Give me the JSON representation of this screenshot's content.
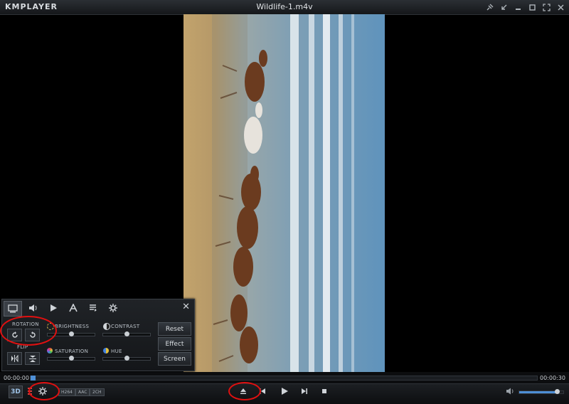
{
  "app": {
    "logo": "KMPLAYER",
    "title": "Wildlife-1.m4v"
  },
  "window_controls": [
    "pin-icon",
    "minimize-to-corner-icon",
    "minimize-icon",
    "maximize-icon",
    "fullscreen-icon",
    "close-icon"
  ],
  "panel": {
    "tabs": [
      "screen-icon",
      "audio-icon",
      "playback-icon",
      "subtitle-icon",
      "playlist-icon",
      "settings-icon"
    ],
    "rotation_label": "ROTATION",
    "flip_label": "FLIP",
    "brightness_label": "BRIGHTNESS",
    "contrast_label": "CONTRAST",
    "saturation_label": "SATURATION",
    "hue_label": "HUE",
    "brightness": 0.5,
    "contrast": 0.5,
    "saturation": 0.5,
    "hue": 0.5,
    "reset_label": "Reset",
    "effect_label": "Effect",
    "screen_label": "Screen",
    "close": "✕"
  },
  "seek": {
    "current": "00:00:00",
    "total": "00:00:30",
    "progress": 0.0
  },
  "controls": {
    "three_d": "3D",
    "codecs": [
      "H264",
      "AAC",
      "2CH"
    ],
    "volume": 0.9
  },
  "colors": {
    "accent": "#4e8fd6",
    "highlight_ring": "#e01010"
  }
}
